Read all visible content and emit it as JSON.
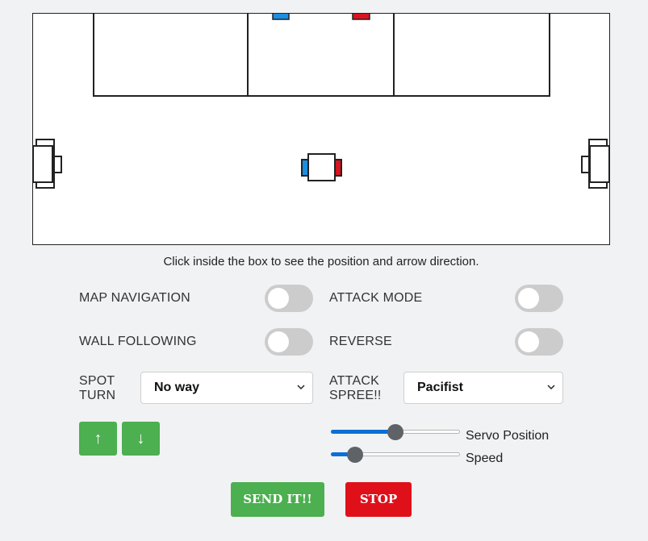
{
  "map": {
    "caption": "Click inside the box to see the position and arrow direction.",
    "colors": {
      "blue": "#1a8fe3",
      "red": "#d8141f",
      "line": "#222222"
    }
  },
  "toggles": {
    "map_navigation": {
      "label": "MAP NAVIGATION",
      "on": false
    },
    "attack_mode": {
      "label": "ATTACK MODE",
      "on": false
    },
    "wall_following": {
      "label": "WALL FOLLOWING",
      "on": false
    },
    "reverse": {
      "label": "REVERSE",
      "on": false
    }
  },
  "selects": {
    "spot_turn": {
      "label_line1": "SPOT",
      "label_line2": "TURN",
      "value": "No way"
    },
    "attack_spree": {
      "label_line1": "ATTACK",
      "label_line2": "SPREE!!",
      "value": "Pacifist"
    }
  },
  "arrows": {
    "up": "↑",
    "down": "↓"
  },
  "sliders": {
    "servo": {
      "label": "Servo Position",
      "value_fraction": 0.5
    },
    "speed": {
      "label": "Speed",
      "value_fraction": 0.19
    }
  },
  "buttons": {
    "send": {
      "label": "SEND IT!!",
      "color": "#4caf50"
    },
    "stop": {
      "label": "STOP",
      "color": "#e0101b"
    }
  }
}
